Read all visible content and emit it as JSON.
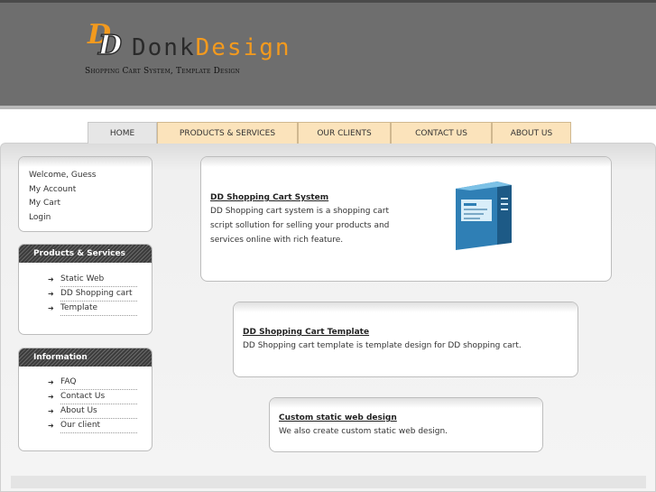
{
  "brand": {
    "logo_mark": "DD",
    "name_part1": "Donk",
    "name_part2": "Design",
    "tagline": "Shopping Cart System, Template Design",
    "colors": {
      "orange": "#f39a1e",
      "dark": "#2a2a2a",
      "header_bg": "#6e6e6e"
    }
  },
  "nav": {
    "items": [
      {
        "label": "HOME",
        "active": true
      },
      {
        "label": "PRODUCTS & SERVICES",
        "active": false
      },
      {
        "label": "OUR CLIENTS",
        "active": false
      },
      {
        "label": "CONTACT US",
        "active": false
      },
      {
        "label": "ABOUT US",
        "active": false
      }
    ]
  },
  "sidebar": {
    "welcome": "Welcome, Guess",
    "account_links": [
      "My Account",
      "My Cart",
      "Login"
    ],
    "products": {
      "heading": "Products & Services",
      "items": [
        "Static Web",
        "DD Shopping cart",
        "Template"
      ]
    },
    "information": {
      "heading": "Information",
      "items": [
        "FAQ",
        "Contact Us",
        "About Us",
        "Our client"
      ]
    },
    "arrow_icon": "right-arrow-icon"
  },
  "features": [
    {
      "title": "DD Shopping Cart System",
      "description": "DD Shopping cart system is a shopping cart script sollution for selling your products and services online with rich feature.",
      "image_icon": "software-box-icon"
    },
    {
      "title": "DD Shopping Cart Template",
      "description": "DD Shopping cart template is template design for DD shopping cart."
    },
    {
      "title": "Custom static web design",
      "description": "We also create custom static web design."
    }
  ]
}
